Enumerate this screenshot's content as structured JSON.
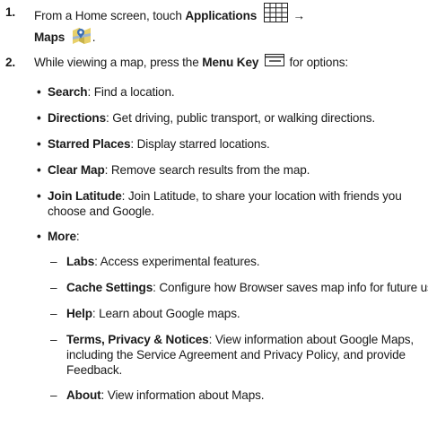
{
  "step1": {
    "number": "1.",
    "intro": "From a Home screen, touch ",
    "applications": "Applications",
    "arrow": "→",
    "maps": "Maps",
    "period": "."
  },
  "step2": {
    "number": "2.",
    "intro": "While viewing a map, press the ",
    "menu_key": "Menu Key",
    "outro": " for options:"
  },
  "options": [
    {
      "name": "Search",
      "desc": ": Find a location."
    },
    {
      "name": "Directions",
      "desc": ": Get driving, public transport, or walking directions."
    },
    {
      "name": "Starred Places",
      "desc": ": Display starred locations."
    },
    {
      "name": "Clear Map",
      "desc": ": Remove search results from the map."
    },
    {
      "name": "Join Latitude",
      "desc": ": Join Latitude, to share your location with friends you",
      "desc2": "choose and Google."
    },
    {
      "name": "More",
      "desc": ":"
    }
  ],
  "more_items": [
    {
      "name": "Labs",
      "desc": ": Access experimental features."
    },
    {
      "name": "Cache Settings",
      "desc": ": Configure how Browser saves map info for future use."
    },
    {
      "name": "Help",
      "desc": ": Learn about Google maps."
    },
    {
      "name": "Terms, Privacy & Notices",
      "desc": ": View information about Google Maps,",
      "desc2": "including the Service Agreement and Privacy Policy, and provide",
      "desc3": "Feedback."
    },
    {
      "name": "About",
      "desc": ": View information about Maps."
    }
  ],
  "bullet": "•",
  "dash": "–",
  "icons": {
    "applications": "grid-icon",
    "maps": "maps-app-icon",
    "menu_key": "menu-key-icon"
  }
}
